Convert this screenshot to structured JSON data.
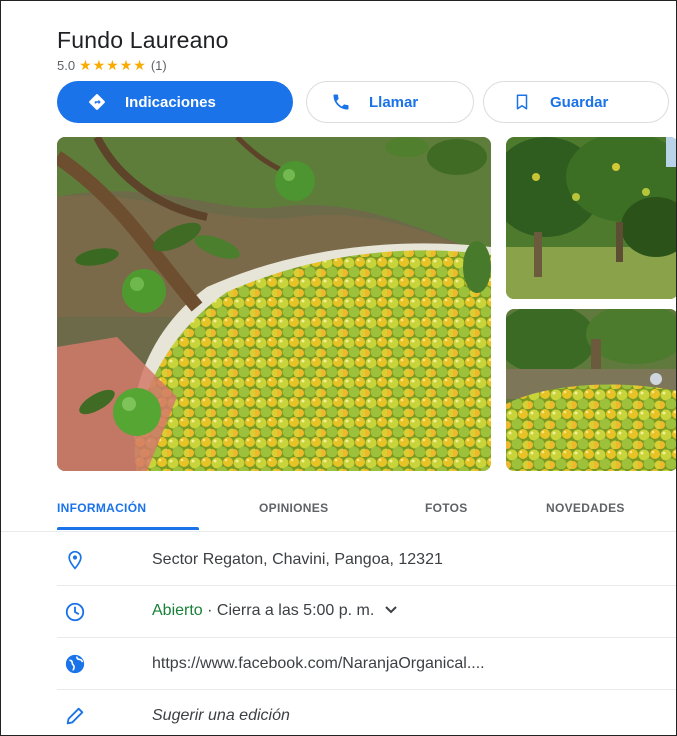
{
  "place": {
    "name": "Fundo Laureano",
    "rating": "5.0",
    "stars": "★★★★★",
    "review_count": "(1)"
  },
  "actions": {
    "directions_label": "Indicaciones",
    "call_label": "Llamar",
    "save_label": "Guardar"
  },
  "tabs": [
    {
      "label": "INFORMACIÓN",
      "active": true
    },
    {
      "label": "OPINIONES",
      "active": false
    },
    {
      "label": "FOTOS",
      "active": false
    },
    {
      "label": "NOVEDADES",
      "active": false
    }
  ],
  "info": {
    "address": "Sector Regaton, Chavini, Pangoa, 12321",
    "hours_status": "Abierto",
    "hours_detail": " · Cierra a las 5:00 p. m.",
    "website": "https://www.facebook.com/NaranjaOrganical....",
    "suggest_edit": "Sugerir una edición"
  },
  "colors": {
    "accent": "#1a73e8",
    "star": "#f9ab00",
    "open": "#188038"
  },
  "icons": {
    "directions": "directions-icon",
    "call": "phone-icon",
    "save": "bookmark-icon",
    "address": "location-pin-icon",
    "hours": "clock-icon",
    "website": "globe-icon",
    "edit": "pencil-icon"
  }
}
